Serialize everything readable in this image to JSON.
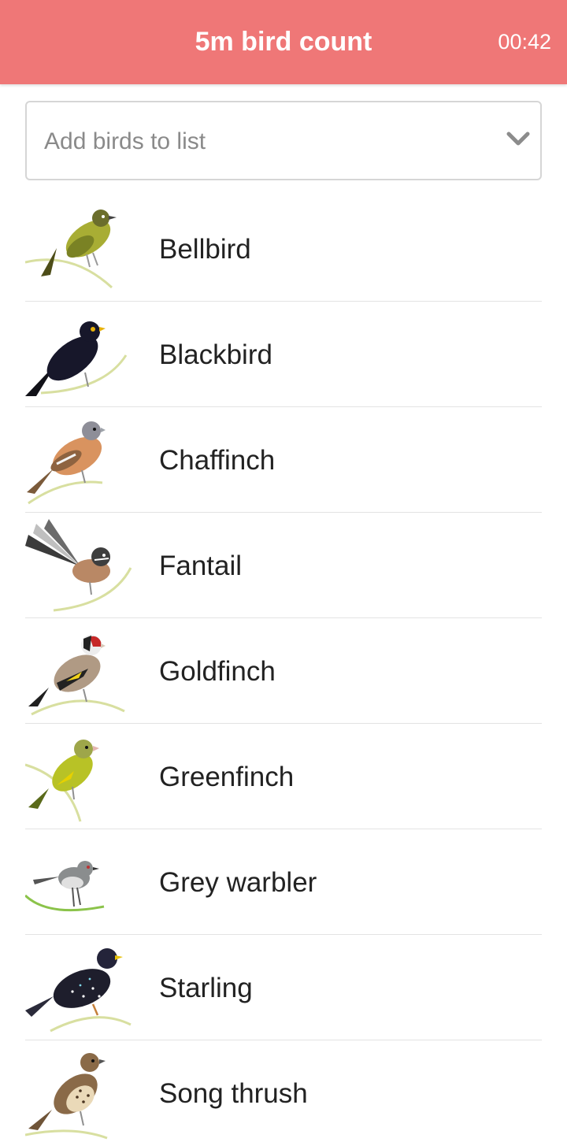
{
  "header": {
    "title": "5m bird count",
    "timer": "00:42"
  },
  "add_select": {
    "placeholder": "Add birds to list",
    "icon": "chevron-down-icon"
  },
  "colors": {
    "header_bg": "#ef7777",
    "header_text": "#ffffff",
    "placeholder_text": "#8a8a8a",
    "item_text": "#222222",
    "divider": "#e3e3e3"
  },
  "birds": [
    {
      "name": "Bellbird",
      "icon": "bellbird-illustration"
    },
    {
      "name": "Blackbird",
      "icon": "blackbird-illustration"
    },
    {
      "name": "Chaffinch",
      "icon": "chaffinch-illustration"
    },
    {
      "name": "Fantail",
      "icon": "fantail-illustration"
    },
    {
      "name": "Goldfinch",
      "icon": "goldfinch-illustration"
    },
    {
      "name": "Greenfinch",
      "icon": "greenfinch-illustration"
    },
    {
      "name": "Grey warbler",
      "icon": "grey-warbler-illustration"
    },
    {
      "name": "Starling",
      "icon": "starling-illustration"
    },
    {
      "name": "Song thrush",
      "icon": "song-thrush-illustration"
    }
  ]
}
